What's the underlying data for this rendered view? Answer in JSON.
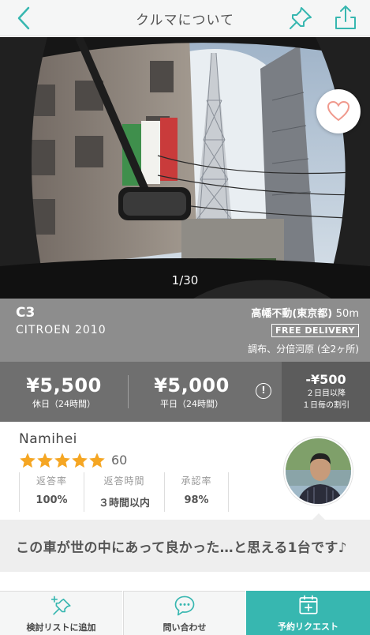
{
  "header": {
    "title": "クルマについて",
    "back_icon": "chevron-left-icon",
    "pin_icon": "pin-icon",
    "share_icon": "share-icon"
  },
  "hero": {
    "counter": "1/30",
    "favorite_icon": "heart-icon"
  },
  "car": {
    "model": "C3",
    "maker_year": "CITROEN 2010",
    "location": "高幡不動(東京都)",
    "distance": "50m",
    "delivery_badge": "FREE DELIVERY",
    "areas": "調布、分倍河原 (全2ヶ所)"
  },
  "prices": {
    "holiday": {
      "amount": "¥5,500",
      "label": "休日（24時間）"
    },
    "weekday": {
      "amount": "¥5,000",
      "label": "平日（24時間）"
    },
    "info_icon": "info-icon",
    "discount": {
      "amount": "-¥500",
      "line1": "２日目以降",
      "line2": "１日毎の割引"
    }
  },
  "host": {
    "name": "Namihei",
    "rating": 5,
    "review_count": "60",
    "stats": [
      {
        "label": "返答率",
        "value": "100%"
      },
      {
        "label": "返答時間",
        "value": "３時間以内"
      },
      {
        "label": "承認率",
        "value": "98%"
      }
    ]
  },
  "tagline": "この車が世の中にあって良かった…と思える1台です♪",
  "bottom_bar": {
    "wishlist": "検討リストに追加",
    "contact": "問い合わせ",
    "request": "予約リクエスト"
  },
  "colors": {
    "accent": "#37b7b0",
    "star": "#f5a623",
    "heart": "#f09a8e",
    "car_band": "#8d8d8d",
    "price_band": "#6f6f6f"
  }
}
